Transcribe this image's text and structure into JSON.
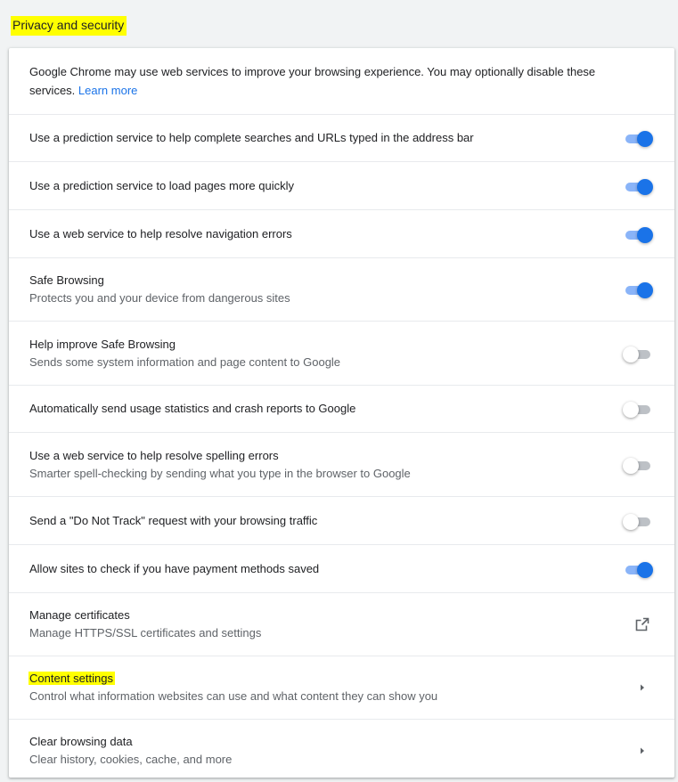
{
  "section": {
    "title": "Privacy and security"
  },
  "intro": {
    "text": "Google Chrome may use web services to improve your browsing experience. You may optionally disable these services. ",
    "learn_more": "Learn more"
  },
  "settings": [
    {
      "label": "Use a prediction service to help complete searches and URLs typed in the address bar",
      "sublabel": "",
      "control": "toggle",
      "on": true
    },
    {
      "label": "Use a prediction service to load pages more quickly",
      "sublabel": "",
      "control": "toggle",
      "on": true
    },
    {
      "label": "Use a web service to help resolve navigation errors",
      "sublabel": "",
      "control": "toggle",
      "on": true
    },
    {
      "label": "Safe Browsing",
      "sublabel": "Protects you and your device from dangerous sites",
      "control": "toggle",
      "on": true
    },
    {
      "label": "Help improve Safe Browsing",
      "sublabel": "Sends some system information and page content to Google",
      "control": "toggle",
      "on": false
    },
    {
      "label": "Automatically send usage statistics and crash reports to Google",
      "sublabel": "",
      "control": "toggle",
      "on": false
    },
    {
      "label": "Use a web service to help resolve spelling errors",
      "sublabel": "Smarter spell-checking by sending what you type in the browser to Google",
      "control": "toggle",
      "on": false
    },
    {
      "label": "Send a \"Do Not Track\" request with your browsing traffic",
      "sublabel": "",
      "control": "toggle",
      "on": false
    },
    {
      "label": "Allow sites to check if you have payment methods saved",
      "sublabel": "",
      "control": "toggle",
      "on": true
    },
    {
      "label": "Manage certificates",
      "sublabel": "Manage HTTPS/SSL certificates and settings",
      "control": "external-link-icon"
    },
    {
      "label": "Content settings",
      "sublabel": "Control what information websites can use and what content they can show you",
      "control": "arrow-right-icon",
      "highlighted": true
    },
    {
      "label": "Clear browsing data",
      "sublabel": "Clear history, cookies, cache, and more",
      "control": "arrow-right-icon"
    }
  ],
  "colors": {
    "accent": "#1a73e8",
    "toggle_on_track": "#8ab4f8",
    "toggle_off_track": "#bdc1c6",
    "highlight": "#ffff00",
    "page_background": "#f1f3f4"
  }
}
